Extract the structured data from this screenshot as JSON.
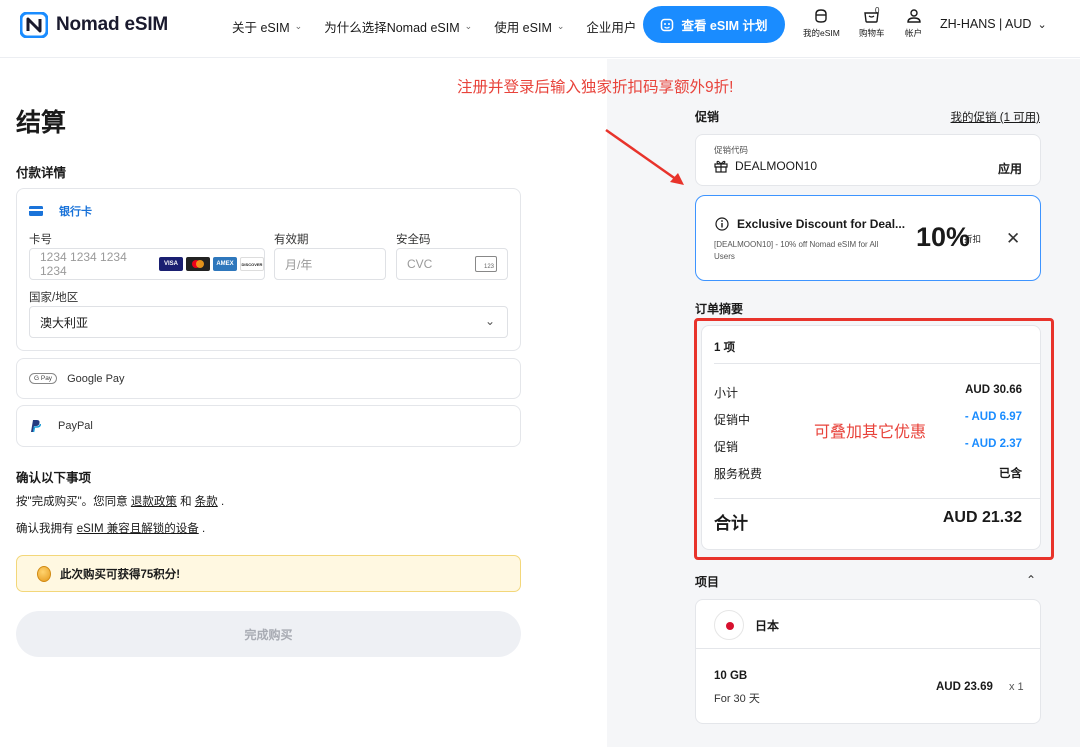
{
  "header": {
    "logo_text": "Nomad eSIM",
    "nav": [
      {
        "label": "关于 eSIM",
        "has_dropdown": true
      },
      {
        "label": "为什么选择Nomad eSIM",
        "has_dropdown": true
      },
      {
        "label": "使用 eSIM",
        "has_dropdown": true
      },
      {
        "label": "企业用户",
        "has_dropdown": false
      }
    ],
    "cta_label": "查看 eSIM 计划",
    "my_esim_label": "我的eSIM",
    "cart_label": "购物车",
    "cart_count": "0",
    "account_label": "帐户",
    "language_label": "ZH-HANS | AUD",
    "accent_color": "#1a8cff"
  },
  "checkout": {
    "title": "结算",
    "payment_section_label": "付款详情",
    "card_method_label": "银行卡",
    "card_number_label": "卡号",
    "card_number_placeholder": "1234 1234 1234 1234",
    "card_brands": [
      "VISA",
      "Mastercard",
      "AMEX",
      "DISCOVER"
    ],
    "expiry_label": "有效期",
    "expiry_placeholder": "月/年",
    "cvc_label": "安全码",
    "cvc_placeholder": "CVC",
    "cvc_icon_text": "123",
    "country_label": "国家/地区",
    "country_value": "澳大利亚",
    "google_pay_badge": "G Pay",
    "google_pay_label": "Google Pay",
    "paypal_label": "PayPal",
    "confirm_section_label": "确认以下事项",
    "terms_prefix": "按\"完成购买\"。您同意",
    "refund_policy_link": "退款政策",
    "terms_and": "和",
    "terms_link": "条款",
    "terms_suffix": ".",
    "device_prefix": "确认我拥有",
    "device_link": "eSIM 兼容且解锁的设备",
    "device_suffix": ".",
    "points_message": "此次购买可获得75积分!",
    "submit_label": "完成购买"
  },
  "annotations": {
    "promo_banner": "注册并登录后输入独家折扣码享额外9折!",
    "stack_note": "可叠加其它优惠",
    "highlight_color": "#e8332b"
  },
  "promo": {
    "section_label": "促销",
    "my_promos_link": "我的促销 (1 可用)",
    "code_field_label": "促销代码",
    "code_value": "DEALMOON10",
    "apply_label": "应用",
    "discount_title": "Exclusive Discount for Deal...",
    "discount_description": "[DEALMOON10] - 10% off Nomad eSIM for All Users",
    "discount_percent": "10%",
    "discount_suffix": "折扣"
  },
  "summary": {
    "section_label": "订单摘要",
    "item_count": "1 项",
    "rows": [
      {
        "label": "小计",
        "value": "AUD 30.66",
        "color": "#1a1a1a"
      },
      {
        "label": "促销中",
        "value": "- AUD 6.97",
        "color": "#1a8cff"
      },
      {
        "label": "促销",
        "value": "- AUD 2.37",
        "color": "#1a8cff"
      },
      {
        "label": "服务税费",
        "value": "已含",
        "color": "#1a1a1a"
      }
    ],
    "total_label": "合计",
    "total_value": "AUD 21.32"
  },
  "items": {
    "section_label": "项目",
    "country": "日本",
    "plan_size": "10 GB",
    "plan_duration": "For 30 天",
    "plan_price": "AUD 23.69",
    "quantity": "x 1"
  }
}
